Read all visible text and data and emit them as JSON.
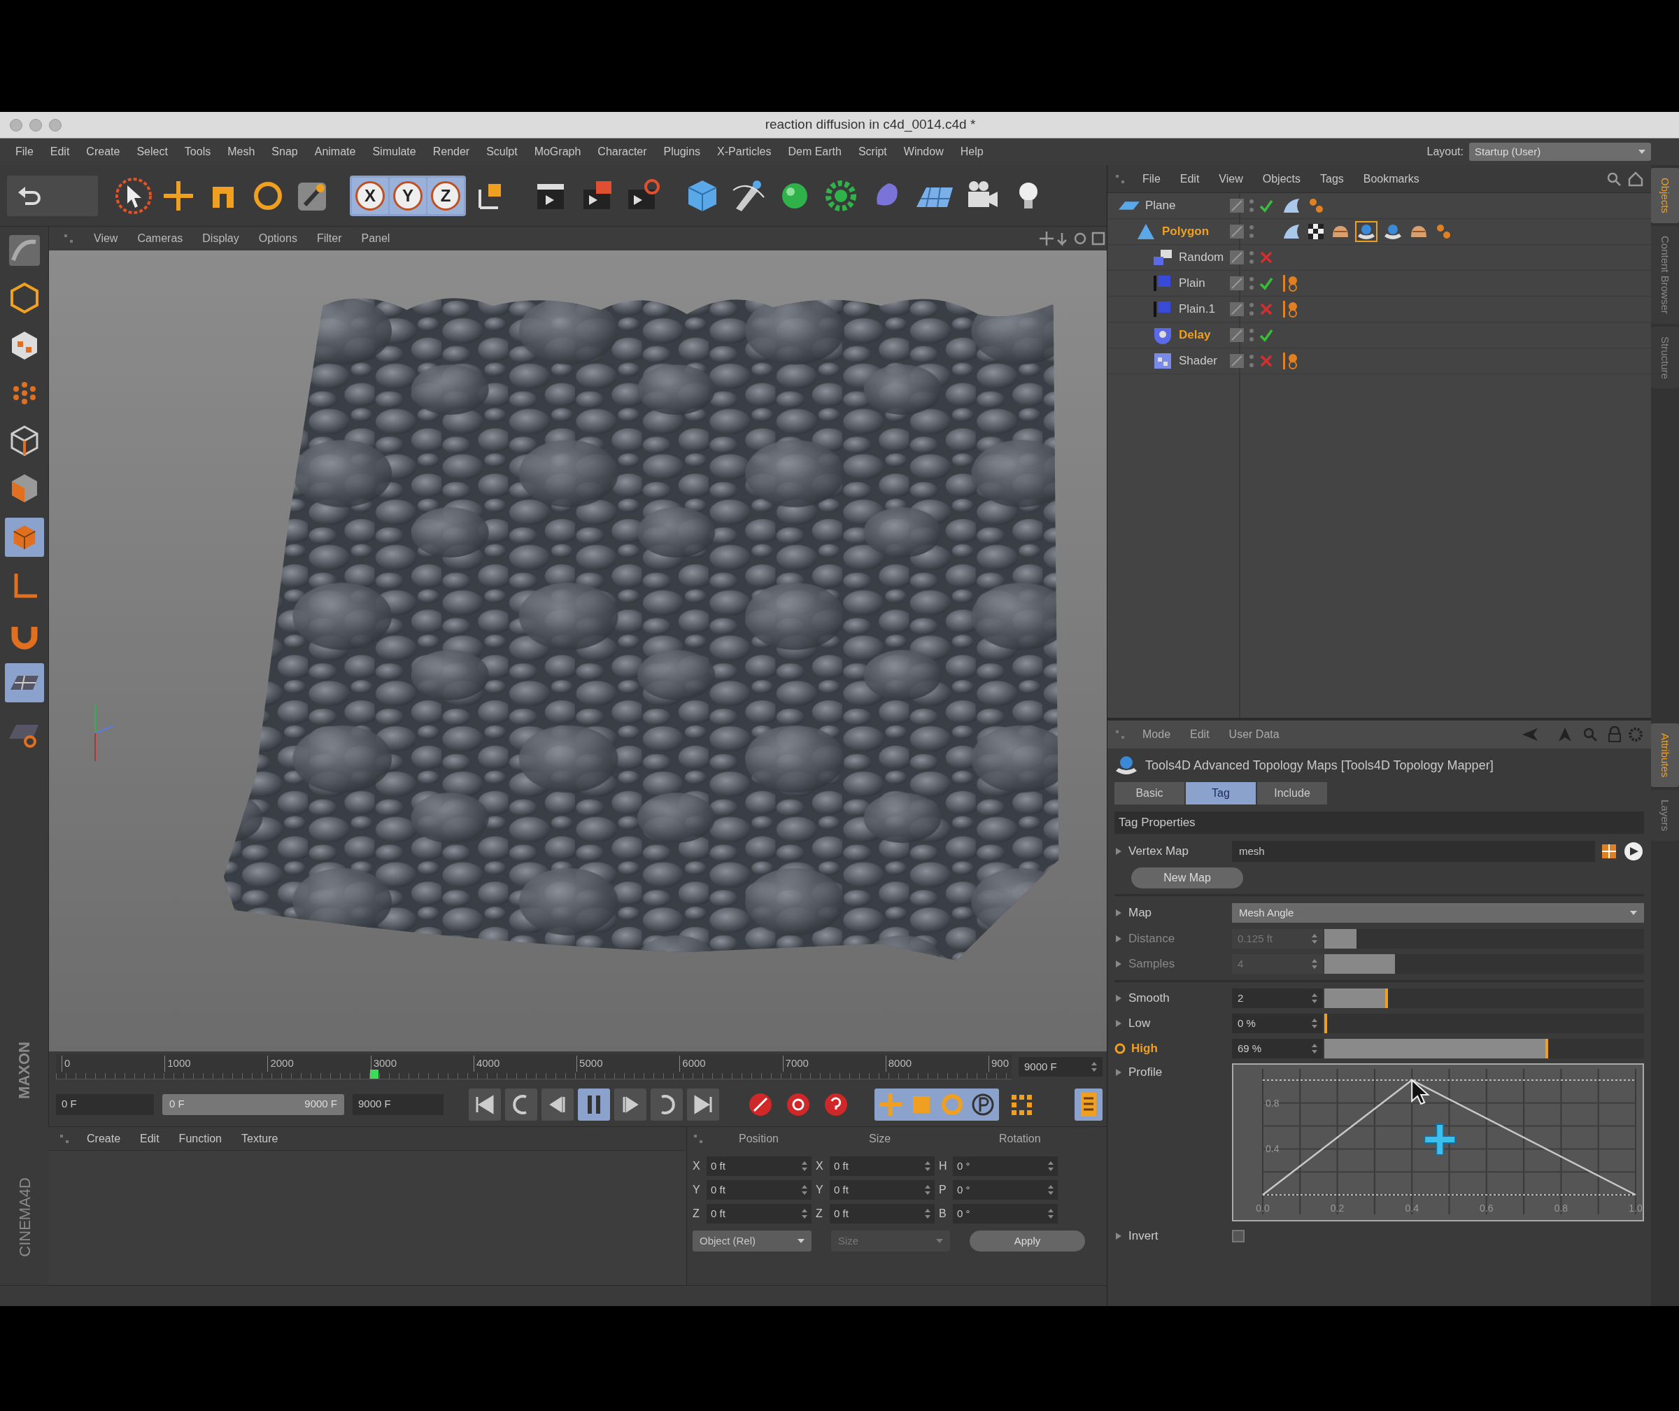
{
  "window": {
    "title": "reaction diffusion in c4d_0014.c4d *"
  },
  "menu_bar": {
    "items": [
      "File",
      "Edit",
      "Create",
      "Select",
      "Tools",
      "Mesh",
      "Snap",
      "Animate",
      "Simulate",
      "Render",
      "Sculpt",
      "MoGraph",
      "Character",
      "Plugins",
      "X-Particles",
      "Dem Earth",
      "Script",
      "Window",
      "Help"
    ],
    "layout_label": "Layout:",
    "layout_value": "Startup (User)"
  },
  "toolbar": {
    "axis_locks": [
      {
        "label": "X",
        "selected": true
      },
      {
        "label": "Y",
        "selected": true
      },
      {
        "label": "Z",
        "selected": true
      }
    ]
  },
  "viewport": {
    "menu": [
      "View",
      "Cameras",
      "Display",
      "Options",
      "Filter",
      "Panel"
    ]
  },
  "object_manager": {
    "menu": [
      "File",
      "Edit",
      "View",
      "Objects",
      "Tags",
      "Bookmarks"
    ],
    "objects": [
      {
        "name": "Plane",
        "kind": "plane",
        "selected": false,
        "enabled": true,
        "tags": [
          {
            "kind": "phong"
          },
          {
            "kind": "dots"
          }
        ],
        "children": [
          {
            "name": "Polygon",
            "kind": "polygon",
            "selected": true,
            "tags": [
              {
                "kind": "phong"
              },
              {
                "kind": "checker"
              },
              {
                "kind": "effector"
              },
              {
                "kind": "topology"
              },
              {
                "kind": "topology-plain"
              },
              {
                "kind": "effector"
              },
              {
                "kind": "dots"
              }
            ],
            "children": [
              {
                "name": "Random",
                "kind": "random",
                "selected": false,
                "enabled": false
              },
              {
                "name": "Plain",
                "kind": "plain",
                "selected": false,
                "enabled": true,
                "tags": [
                  {
                    "kind": "field"
                  }
                ]
              },
              {
                "name": "Plain.1",
                "kind": "plain",
                "selected": false,
                "enabled": false,
                "tags": [
                  {
                    "kind": "field"
                  }
                ]
              },
              {
                "name": "Delay",
                "kind": "delay",
                "selected": true,
                "enabled": true
              },
              {
                "name": "Shader",
                "kind": "shader",
                "selected": false,
                "enabled": false,
                "tags": [
                  {
                    "kind": "field"
                  }
                ]
              }
            ]
          }
        ]
      }
    ]
  },
  "side_tabs_top": [
    {
      "label": "Objects",
      "selected": true
    },
    {
      "label": "Content Browser",
      "selected": false
    },
    {
      "label": "Structure",
      "selected": false
    }
  ],
  "attribute_manager": {
    "menu": [
      "Mode",
      "Edit",
      "User Data"
    ],
    "title": "Tools4D Advanced Topology Maps [Tools4D Topology Mapper]",
    "tabs": [
      {
        "label": "Basic",
        "selected": false
      },
      {
        "label": "Tag",
        "selected": true
      },
      {
        "label": "Include",
        "selected": false
      }
    ],
    "section": "Tag Properties",
    "groups": [
      {
        "parameters": [
          {
            "kind": "link",
            "label": "Vertex Map",
            "value": "mesh"
          },
          {
            "kind": "button",
            "label": "New Map"
          }
        ]
      },
      {
        "parameters": [
          {
            "kind": "dropdown",
            "label": "Map",
            "value": "Mesh Angle"
          },
          {
            "kind": "slider",
            "label": "Distance",
            "value": "0.125 ft",
            "level": 0.1,
            "disabled": true,
            "animated": false
          },
          {
            "kind": "slider",
            "label": "Samples",
            "value": "4",
            "level": 0.22,
            "disabled": true,
            "animated": false
          }
        ]
      },
      {
        "parameters": [
          {
            "kind": "slider",
            "label": "Smooth",
            "value": "2",
            "level": 0.2,
            "disabled": false,
            "animated": false
          },
          {
            "kind": "slider",
            "label": "Low",
            "value": "0 %",
            "level": 0,
            "disabled": false,
            "animated": false
          },
          {
            "kind": "slider",
            "label": "High",
            "value": "69 %",
            "level": 0.7,
            "disabled": false,
            "animated": true
          },
          {
            "kind": "graph",
            "label": "Profile",
            "chart_data": {
              "type": "line",
              "grid": true,
              "x": [
                0,
                0.4,
                1
              ],
              "series": [
                {
                  "color": "#c8c8c8",
                  "values": [
                    0,
                    1,
                    0
                  ]
                }
              ],
              "xlim": [
                0,
                1
              ],
              "ylim": [
                0,
                1
              ],
              "xticks": [
                {
                  "value": 0,
                  "label": "0.0"
                },
                {
                  "value": 0.2,
                  "label": "0.2"
                },
                {
                  "value": 0.4,
                  "label": "0.4"
                },
                {
                  "value": 0.6,
                  "label": "0.6"
                },
                {
                  "value": 0.8,
                  "label": "0.8"
                },
                {
                  "value": 1,
                  "label": "1.0"
                }
              ],
              "yticks": [
                {
                  "value": 0.4,
                  "label": "0.4"
                },
                {
                  "value": 0.8,
                  "label": "0.8"
                }
              ]
            }
          },
          {
            "kind": "checkbox",
            "label": "Invert",
            "checked": false
          }
        ]
      }
    ]
  },
  "side_tabs_bottom": [
    {
      "label": "Attributes",
      "selected": true
    },
    {
      "label": "Layers",
      "selected": false
    }
  ],
  "timeline": {
    "ticks": [
      "0",
      "1000",
      "2000",
      "3000",
      "4000",
      "5000",
      "6000",
      "7000",
      "8000",
      "900"
    ],
    "level": 0.333,
    "end_field": "9000 F"
  },
  "transport": {
    "current": "0 F",
    "range_start": "0 F",
    "range_end": "9000 F",
    "end": "9000 F",
    "playing": true
  },
  "material_manager": {
    "menu": [
      "Create",
      "Edit",
      "Function",
      "Texture"
    ]
  },
  "coordinates": {
    "headers": [
      "Position",
      "Size",
      "Rotation"
    ],
    "rows": [
      {
        "axis": "X",
        "position": "0 ft",
        "size_axis": "X",
        "size": "0 ft",
        "rotation_axis": "H",
        "rotation": "0 °"
      },
      {
        "axis": "Y",
        "position": "0 ft",
        "size_axis": "Y",
        "size": "0 ft",
        "rotation_axis": "P",
        "rotation": "0 °"
      },
      {
        "axis": "Z",
        "position": "0 ft",
        "size_axis": "Z",
        "size": "0 ft",
        "rotation_axis": "B",
        "rotation": "0 °"
      }
    ],
    "mode": "Object (Rel)",
    "size_mode": "Size",
    "apply": "Apply"
  },
  "logo": {
    "brand": "MAXON",
    "product": "CINEMA4D"
  }
}
